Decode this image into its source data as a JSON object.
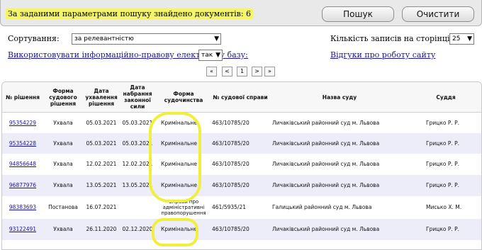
{
  "search_result": {
    "message": "За заданими параметрами пошуку знайдено документів: 6",
    "search_button": "Пошук",
    "clear_button": "Очистити"
  },
  "options": {
    "sort_label": "Сортування:",
    "sort_value": "за релевантністю",
    "per_page_label": "Кількість записів на сторінці:",
    "per_page_value": "25",
    "use_base_link": "Використовувати інформаційно-правову електронну базу:",
    "use_base_value": "так",
    "feedback_link": "Відгуки про роботу сайту"
  },
  "pager": {
    "first": "«",
    "prev": "<",
    "current": "1",
    "next": ">",
    "last": "»"
  },
  "table": {
    "headers": {
      "num": "№ рішення",
      "form": "Форма судового рішення",
      "date_adopt": "Дата ухвалення рішення",
      "date_force": "Дата набрання законної сили",
      "proc": "Форма судочинства",
      "case": "№ судової справи",
      "court": "Назва суду",
      "judge": "Суддя"
    },
    "rows": [
      {
        "num": "95354229",
        "form": "Ухвала",
        "date_adopt": "05.03.2021",
        "date_force": "05.03.2021",
        "proc": "Кримінальне",
        "case": "463/10785/20",
        "court": "Личаківський районний суд м. Львова",
        "judge": "Грицко Р. Р."
      },
      {
        "num": "95354228",
        "form": "Ухвала",
        "date_adopt": "05.03.2021",
        "date_force": "05.03.2021",
        "proc": "Кримінальне",
        "case": "463/10785/20",
        "court": "Личаківський районний суд м. Львова",
        "judge": "Грицко Р. Р."
      },
      {
        "num": "94856648",
        "form": "Ухвала",
        "date_adopt": "12.02.2021",
        "date_force": "12.02.2021",
        "proc": "Кримінальне",
        "case": "463/10785/20",
        "court": "Личаківський районний суд м. Львова",
        "judge": "Грицко Р. Р."
      },
      {
        "num": "96877976",
        "form": "Ухвала",
        "date_adopt": "13.05.2021",
        "date_force": "13.05.2021",
        "proc": "Кримінальне",
        "case": "463/10785/20",
        "court": "Личаківський районний суд м. Львова",
        "judge": "Грицко Р. Р."
      },
      {
        "num": "98383693",
        "form": "Постанова",
        "date_adopt": "16.07.2021",
        "date_force": "",
        "proc": "Справи про адміністративні правопорушення",
        "case": "461/5935/21",
        "court": "Галицький районний суд м. Львова",
        "judge": "Мисько Х. М."
      },
      {
        "num": "93122491",
        "form": "Ухвала",
        "date_adopt": "26.11.2020",
        "date_force": "02.12.2020",
        "proc": "Кримінальне",
        "case": "463/10785/20",
        "court": "Личаківський районний суд м. Львова",
        "judge": "Грицко Р. Р."
      }
    ]
  },
  "colors": {
    "highlight": "#f1ef3c",
    "link": "#1a14a3",
    "row_alt": "#ecedf8"
  }
}
